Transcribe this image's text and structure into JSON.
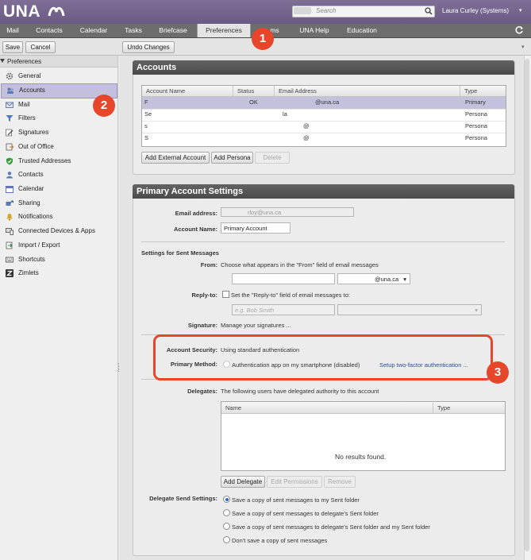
{
  "app": {
    "logo": "UNA"
  },
  "search": {
    "placeholder": "Search"
  },
  "user": {
    "name": "Laura Curley (Systems)"
  },
  "tabs": [
    "Mail",
    "Contacts",
    "Calendar",
    "Tasks",
    "Briefcase",
    "Preferences",
    "ms",
    "UNA Help",
    "Education"
  ],
  "toolbar": {
    "save": "Save",
    "cancel": "Cancel",
    "undo": "Undo Changes"
  },
  "sidebar": {
    "title": "Preferences",
    "items": [
      "General",
      "Accounts",
      "Mail",
      "Filters",
      "Signatures",
      "Out of Office",
      "Trusted Addresses",
      "Contacts",
      "Calendar",
      "Sharing",
      "Notifications",
      "Connected Devices & Apps",
      "Import / Export",
      "Shortcuts",
      "Zimlets"
    ]
  },
  "accounts": {
    "title": "Accounts",
    "columns": [
      "Account Name",
      "Status",
      "Email Address",
      "Type"
    ],
    "rows": [
      {
        "name": "F",
        "status": "OK",
        "email": "@una.ca",
        "type": "Primary"
      },
      {
        "name": "Se",
        "status": "",
        "email": "la",
        "type": "Persona"
      },
      {
        "name": "s",
        "status": "",
        "email": "@",
        "type": "Persona"
      },
      {
        "name": "S",
        "status": "",
        "email": "@",
        "type": "Persona"
      }
    ],
    "buttons": {
      "add_external": "Add External Account",
      "add_persona": "Add Persona",
      "delete": "Delete"
    }
  },
  "primary": {
    "title": "Primary Account Settings",
    "email_label": "Email address:",
    "email_value": "rloy@una.ca",
    "account_name_label": "Account Name:",
    "account_name_value": "Primary Account",
    "sent_heading": "Settings for Sent Messages",
    "from_label": "From:",
    "from_text": "Choose what appears in the \"From\" field of email messages",
    "from_domain": "@una.ca",
    "replyto_label": "Reply-to:",
    "replyto_text": "Set the \"Reply-to\" field of email messages to:",
    "replyto_placeholder": "e.g. Bob Smith",
    "signature_label": "Signature:",
    "signature_link": "Manage your signatures ...",
    "security_label": "Account Security:",
    "security_value": "Using standard authentication",
    "method_label": "Primary Method:",
    "method_value": "Authentication app on my smartphone (disabled)",
    "method_link": "Setup two-factor authentication ...",
    "delegates_label": "Delegates:",
    "delegates_text": "The following users have delegated authority to this account",
    "delegates_columns": [
      "Name",
      "Type"
    ],
    "delegates_empty": "No results found.",
    "delegate_buttons": {
      "add": "Add Delegate",
      "edit": "Edit Permissions",
      "remove": "Remove"
    },
    "send_settings_label": "Delegate Send Settings:",
    "send_options": [
      "Save a copy of sent messages to my Sent folder",
      "Save a copy of sent messages to delegate's Sent folder",
      "Save a copy of sent messages to delegate's Sent folder and my Sent folder",
      "Don't save a copy of sent messages"
    ]
  },
  "callouts": [
    "1",
    "2",
    "3"
  ],
  "colors": {
    "topbar": "#6b5b84",
    "callout": "#e8462b",
    "selected": "#c4bfdc",
    "panel_head": "#555555"
  }
}
